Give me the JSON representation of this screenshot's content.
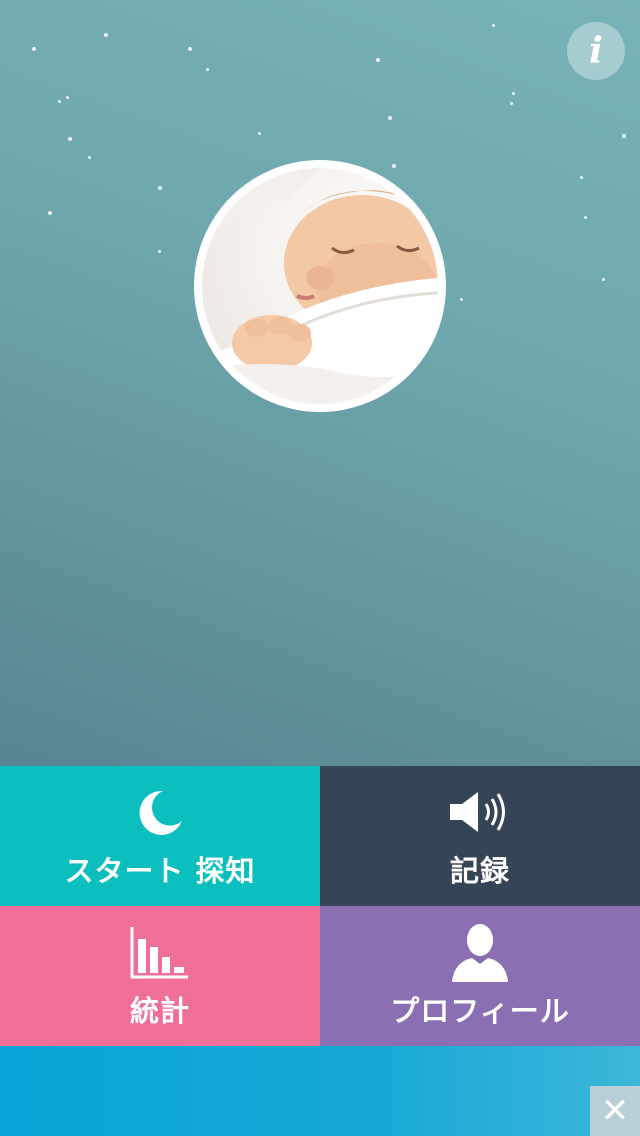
{
  "header": {
    "info_icon": "info-icon",
    "info_label": "i"
  },
  "avatar": {
    "description_icon": "baby-photo"
  },
  "menu": {
    "start": {
      "label": "スタート 探知",
      "icon": "moon-icon",
      "color": "#0cbfbf"
    },
    "record": {
      "label": "記録",
      "icon": "speaker-icon",
      "color": "#364555"
    },
    "stats": {
      "label": "統計",
      "icon": "bar-chart-icon",
      "color": "#f06f97"
    },
    "profile": {
      "label": "プロフィール",
      "icon": "user-icon",
      "color": "#8a70b2"
    }
  },
  "ad_banner": {
    "close_label": "✕",
    "color": "#07a4d5"
  }
}
